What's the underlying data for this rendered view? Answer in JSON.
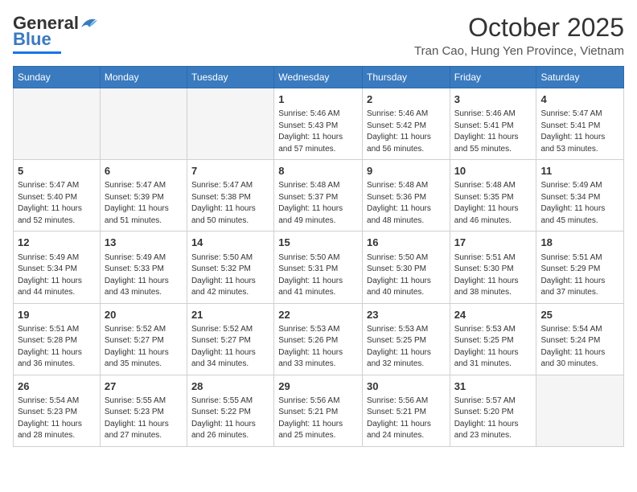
{
  "header": {
    "logo_general": "General",
    "logo_blue": "Blue",
    "month_title": "October 2025",
    "location": "Tran Cao, Hung Yen Province, Vietnam"
  },
  "weekdays": [
    "Sunday",
    "Monday",
    "Tuesday",
    "Wednesday",
    "Thursday",
    "Friday",
    "Saturday"
  ],
  "weeks": [
    [
      {
        "day": "",
        "info": ""
      },
      {
        "day": "",
        "info": ""
      },
      {
        "day": "",
        "info": ""
      },
      {
        "day": "1",
        "info": "Sunrise: 5:46 AM\nSunset: 5:43 PM\nDaylight: 11 hours\nand 57 minutes."
      },
      {
        "day": "2",
        "info": "Sunrise: 5:46 AM\nSunset: 5:42 PM\nDaylight: 11 hours\nand 56 minutes."
      },
      {
        "day": "3",
        "info": "Sunrise: 5:46 AM\nSunset: 5:41 PM\nDaylight: 11 hours\nand 55 minutes."
      },
      {
        "day": "4",
        "info": "Sunrise: 5:47 AM\nSunset: 5:41 PM\nDaylight: 11 hours\nand 53 minutes."
      }
    ],
    [
      {
        "day": "5",
        "info": "Sunrise: 5:47 AM\nSunset: 5:40 PM\nDaylight: 11 hours\nand 52 minutes."
      },
      {
        "day": "6",
        "info": "Sunrise: 5:47 AM\nSunset: 5:39 PM\nDaylight: 11 hours\nand 51 minutes."
      },
      {
        "day": "7",
        "info": "Sunrise: 5:47 AM\nSunset: 5:38 PM\nDaylight: 11 hours\nand 50 minutes."
      },
      {
        "day": "8",
        "info": "Sunrise: 5:48 AM\nSunset: 5:37 PM\nDaylight: 11 hours\nand 49 minutes."
      },
      {
        "day": "9",
        "info": "Sunrise: 5:48 AM\nSunset: 5:36 PM\nDaylight: 11 hours\nand 48 minutes."
      },
      {
        "day": "10",
        "info": "Sunrise: 5:48 AM\nSunset: 5:35 PM\nDaylight: 11 hours\nand 46 minutes."
      },
      {
        "day": "11",
        "info": "Sunrise: 5:49 AM\nSunset: 5:34 PM\nDaylight: 11 hours\nand 45 minutes."
      }
    ],
    [
      {
        "day": "12",
        "info": "Sunrise: 5:49 AM\nSunset: 5:34 PM\nDaylight: 11 hours\nand 44 minutes."
      },
      {
        "day": "13",
        "info": "Sunrise: 5:49 AM\nSunset: 5:33 PM\nDaylight: 11 hours\nand 43 minutes."
      },
      {
        "day": "14",
        "info": "Sunrise: 5:50 AM\nSunset: 5:32 PM\nDaylight: 11 hours\nand 42 minutes."
      },
      {
        "day": "15",
        "info": "Sunrise: 5:50 AM\nSunset: 5:31 PM\nDaylight: 11 hours\nand 41 minutes."
      },
      {
        "day": "16",
        "info": "Sunrise: 5:50 AM\nSunset: 5:30 PM\nDaylight: 11 hours\nand 40 minutes."
      },
      {
        "day": "17",
        "info": "Sunrise: 5:51 AM\nSunset: 5:30 PM\nDaylight: 11 hours\nand 38 minutes."
      },
      {
        "day": "18",
        "info": "Sunrise: 5:51 AM\nSunset: 5:29 PM\nDaylight: 11 hours\nand 37 minutes."
      }
    ],
    [
      {
        "day": "19",
        "info": "Sunrise: 5:51 AM\nSunset: 5:28 PM\nDaylight: 11 hours\nand 36 minutes."
      },
      {
        "day": "20",
        "info": "Sunrise: 5:52 AM\nSunset: 5:27 PM\nDaylight: 11 hours\nand 35 minutes."
      },
      {
        "day": "21",
        "info": "Sunrise: 5:52 AM\nSunset: 5:27 PM\nDaylight: 11 hours\nand 34 minutes."
      },
      {
        "day": "22",
        "info": "Sunrise: 5:53 AM\nSunset: 5:26 PM\nDaylight: 11 hours\nand 33 minutes."
      },
      {
        "day": "23",
        "info": "Sunrise: 5:53 AM\nSunset: 5:25 PM\nDaylight: 11 hours\nand 32 minutes."
      },
      {
        "day": "24",
        "info": "Sunrise: 5:53 AM\nSunset: 5:25 PM\nDaylight: 11 hours\nand 31 minutes."
      },
      {
        "day": "25",
        "info": "Sunrise: 5:54 AM\nSunset: 5:24 PM\nDaylight: 11 hours\nand 30 minutes."
      }
    ],
    [
      {
        "day": "26",
        "info": "Sunrise: 5:54 AM\nSunset: 5:23 PM\nDaylight: 11 hours\nand 28 minutes."
      },
      {
        "day": "27",
        "info": "Sunrise: 5:55 AM\nSunset: 5:23 PM\nDaylight: 11 hours\nand 27 minutes."
      },
      {
        "day": "28",
        "info": "Sunrise: 5:55 AM\nSunset: 5:22 PM\nDaylight: 11 hours\nand 26 minutes."
      },
      {
        "day": "29",
        "info": "Sunrise: 5:56 AM\nSunset: 5:21 PM\nDaylight: 11 hours\nand 25 minutes."
      },
      {
        "day": "30",
        "info": "Sunrise: 5:56 AM\nSunset: 5:21 PM\nDaylight: 11 hours\nand 24 minutes."
      },
      {
        "day": "31",
        "info": "Sunrise: 5:57 AM\nSunset: 5:20 PM\nDaylight: 11 hours\nand 23 minutes."
      },
      {
        "day": "",
        "info": ""
      }
    ]
  ]
}
